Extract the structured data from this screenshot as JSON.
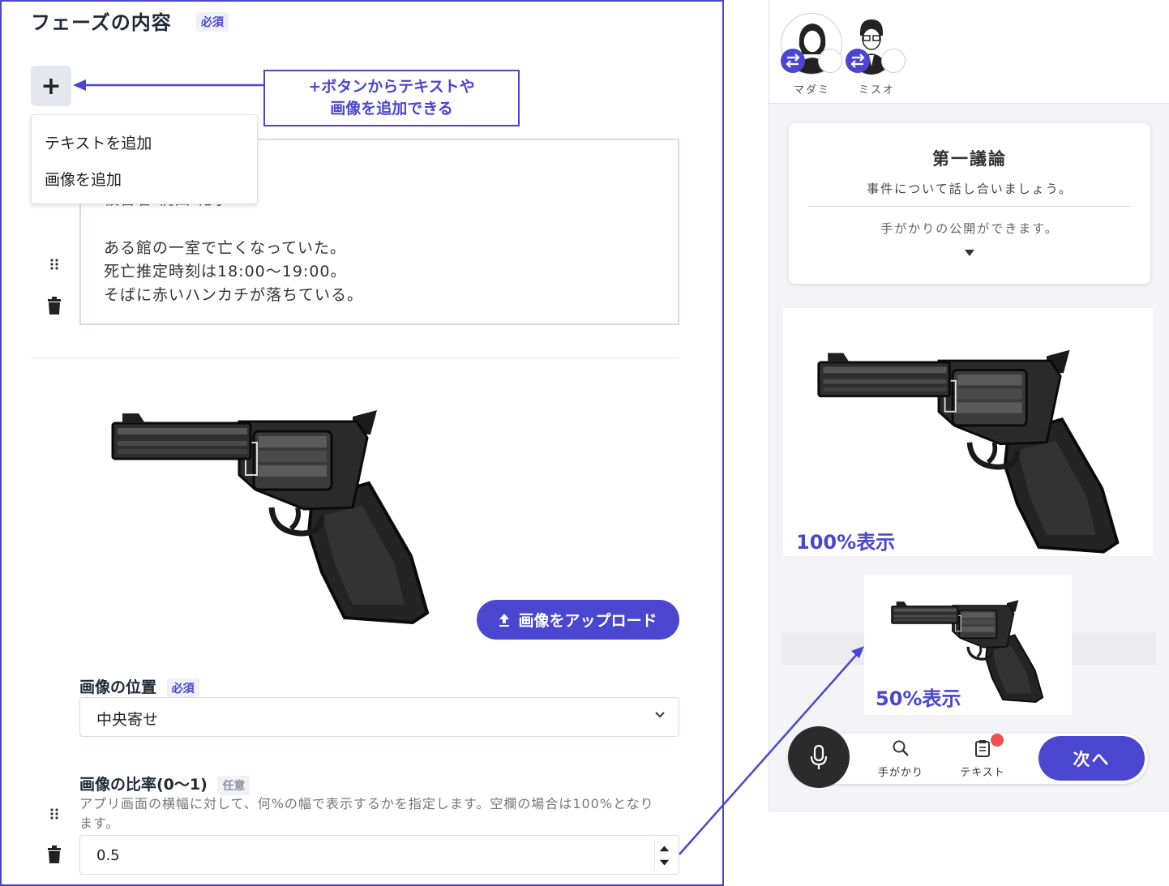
{
  "editor": {
    "section_title": "フェーズの内容",
    "required_badge": "必須",
    "add_button": "+",
    "callout": {
      "line1": "+ボタンからテキストや",
      "line2": "画像を追加できる"
    },
    "menu": {
      "add_text": "テキストを追加",
      "add_image": "画像を追加"
    },
    "text_block": {
      "partial_line": "被害者:桃田 花子",
      "line1": "ある館の一室で亡くなっていた。",
      "line2": "死亡推定時刻は18:00～19:00。",
      "line3": "そばに赤いハンカチが落ちている。"
    },
    "image_block": {
      "upload_button": "画像をアップロード",
      "position_label": "画像の位置",
      "position_badge": "必須",
      "position_value": "中央寄せ",
      "ratio_label": "画像の比率(0～1)",
      "ratio_badge": "任意",
      "ratio_help": "アプリ画面の横幅に対して、何%の幅で表示するかを指定します。空欄の場合は100%となります。",
      "ratio_value": "0.5"
    }
  },
  "preview": {
    "characters": [
      {
        "name": "マダミ"
      },
      {
        "name": "ミスオ"
      }
    ],
    "card": {
      "title": "第一議論",
      "subtitle": "事件について話し合いましょう。",
      "note": "手がかりの公開ができます。"
    },
    "label_100": "100%表示",
    "label_50": "50%表示",
    "toolbar": {
      "clues": "手がかり",
      "text": "テキスト",
      "next": "次へ"
    }
  },
  "colors": {
    "accent": "#4a46d0",
    "notification": "#f05050"
  },
  "icons": [
    "plus-icon",
    "drag-handle-icon",
    "trash-icon",
    "upload-icon",
    "chevron-down-icon",
    "revolver-image",
    "swap-icon",
    "mic-icon",
    "search-icon",
    "clipboard-icon",
    "caret-down-icon"
  ]
}
